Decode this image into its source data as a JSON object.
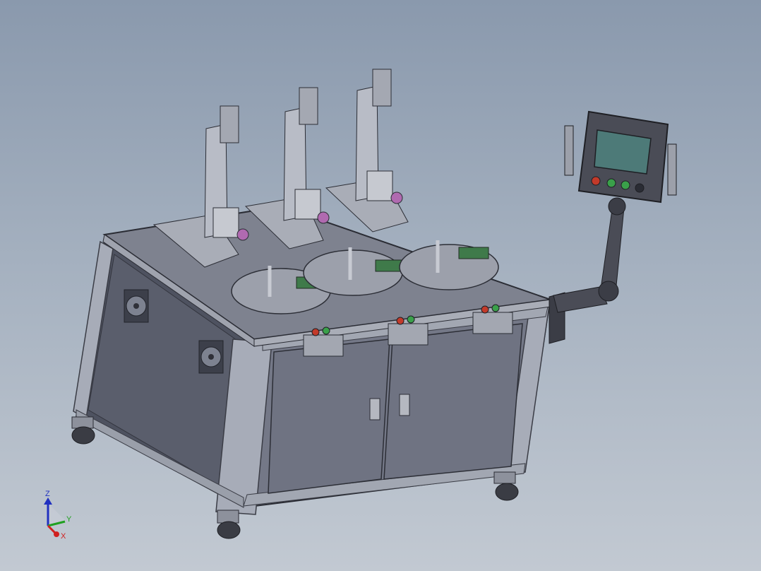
{
  "triad": {
    "z": "Z",
    "y": "Y",
    "x": "X"
  },
  "colors": {
    "background_top": "#8a99ad",
    "background_bottom": "#c2c9d2",
    "frame": "#9aa0ad",
    "panel": "#6c7080",
    "side_panel": "#4e5260",
    "tabletop": "#7e828f",
    "hmi_screen": "#4d7a78",
    "button_red": "#c23a2a",
    "button_green": "#3aa04a",
    "axis_x": "#d02020",
    "axis_y": "#20a020",
    "axis_z": "#2030c0"
  }
}
